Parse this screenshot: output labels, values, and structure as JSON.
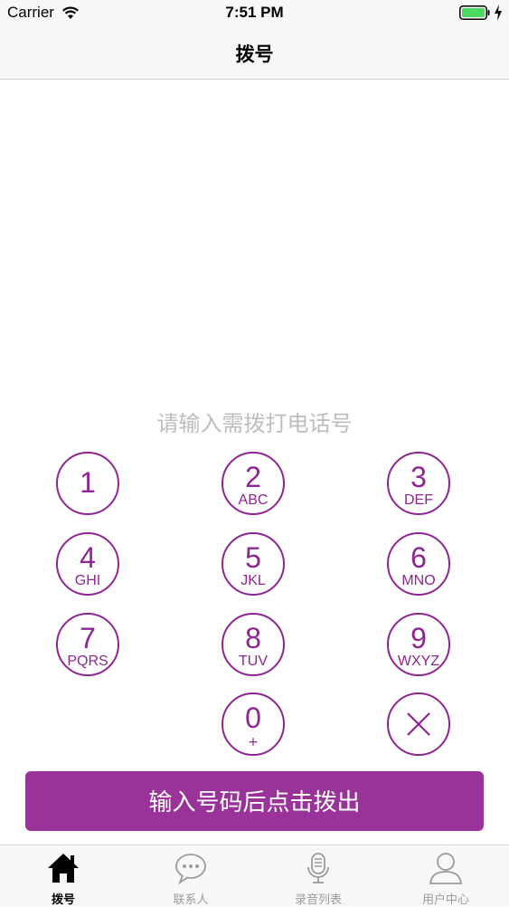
{
  "status_bar": {
    "carrier": "Carrier",
    "time": "7:51 PM",
    "battery_color": "#4cd964"
  },
  "nav": {
    "title": "拨号"
  },
  "dialer": {
    "placeholder": "请输入需拨打电话号",
    "keys": [
      {
        "digit": "1",
        "letters": ""
      },
      {
        "digit": "2",
        "letters": "ABC"
      },
      {
        "digit": "3",
        "letters": "DEF"
      },
      {
        "digit": "4",
        "letters": "GHI"
      },
      {
        "digit": "5",
        "letters": "JKL"
      },
      {
        "digit": "6",
        "letters": "MNO"
      },
      {
        "digit": "7",
        "letters": "PQRS"
      },
      {
        "digit": "8",
        "letters": "TUV"
      },
      {
        "digit": "9",
        "letters": "WXYZ"
      },
      {
        "digit": "0",
        "letters": "+"
      }
    ],
    "delete_icon": "close-x-icon",
    "accent_color": "#8e2592"
  },
  "call_button": {
    "label": "输入号码后点击拨出",
    "color": "#993399"
  },
  "tabs": [
    {
      "label": "拨号",
      "icon": "home-icon",
      "active": true
    },
    {
      "label": "联系人",
      "icon": "chat-bubble-icon",
      "active": false
    },
    {
      "label": "录音列表",
      "icon": "microphone-icon",
      "active": false
    },
    {
      "label": "用户中心",
      "icon": "user-icon",
      "active": false
    }
  ]
}
